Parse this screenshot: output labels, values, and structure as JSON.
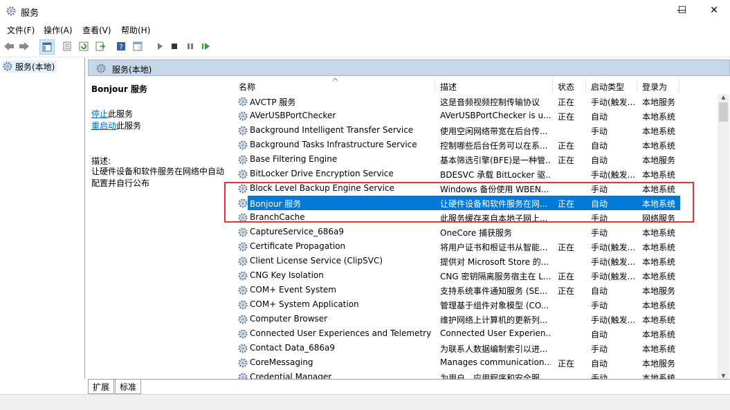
{
  "window": {
    "title": "服务",
    "minimize_icon": "minimize-icon",
    "maximize_icon": "maximize-icon",
    "close_icon": "close-icon"
  },
  "menu": [
    "文件(F)",
    "操作(A)",
    "查看(V)",
    "帮助(H)"
  ],
  "toolbar_icons": [
    "back-arrow-icon",
    "forward-arrow-icon",
    "console-tree-icon",
    "properties-icon",
    "refresh-icon",
    "export-icon",
    "help-icon",
    "show-hide-icon",
    "play-icon",
    "stop-icon",
    "pause-icon",
    "resume-icon"
  ],
  "tree": {
    "root_label": "服务(本地)"
  },
  "panel": {
    "header": "服务(本地)"
  },
  "details": {
    "service_name": "Bonjour 服务",
    "stop_link": "停止",
    "stop_suffix": "此服务",
    "restart_link": "重启动",
    "restart_suffix": "此服务",
    "desc_label": "描述:",
    "desc_text": "让硬件设备和软件服务在网络中自动配置并自行公布"
  },
  "columns": {
    "name": "名称",
    "desc": "描述",
    "status": "状态",
    "startup": "启动类型",
    "logon": "登录为"
  },
  "services": [
    {
      "name": "AVCTP 服务",
      "desc": "这是音频视频控制传输协议",
      "status": "正在",
      "startup": "手动(触发...",
      "logon": "本地服务"
    },
    {
      "name": "AVerUSBPortChecker",
      "desc": "AVerUSBPortChecker is u...",
      "status": "正在",
      "startup": "自动",
      "logon": "本地系统"
    },
    {
      "name": "Background Intelligent Transfer Service",
      "desc": "使用空闲网络带宽在后台传...",
      "status": "",
      "startup": "手动",
      "logon": "本地系统"
    },
    {
      "name": "Background Tasks Infrastructure Service",
      "desc": "控制哪些后台任务可以在系...",
      "status": "正在",
      "startup": "自动",
      "logon": "本地系统"
    },
    {
      "name": "Base Filtering Engine",
      "desc": "基本筛选引擎(BFE)是一种管...",
      "status": "正在",
      "startup": "自动",
      "logon": "本地服务"
    },
    {
      "name": "BitLocker Drive Encryption Service",
      "desc": "BDESVC 承载 BitLocker 驱...",
      "status": "",
      "startup": "手动(触发...",
      "logon": "本地系统"
    },
    {
      "name": "Block Level Backup Engine Service",
      "desc": "Windows 备份使用 WBEN...",
      "status": "",
      "startup": "手动",
      "logon": "本地系统"
    },
    {
      "name": "Bonjour 服务",
      "desc": "让硬件设备和软件服务在网...",
      "status": "正在",
      "startup": "自动",
      "logon": "本地系统",
      "selected": true
    },
    {
      "name": "BranchCache",
      "desc": "此服务缓存来自本地子网上...",
      "status": "",
      "startup": "手动",
      "logon": "网络服务"
    },
    {
      "name": "CaptureService_686a9",
      "desc": "OneCore 捕获服务",
      "status": "",
      "startup": "手动",
      "logon": "本地系统"
    },
    {
      "name": "Certificate Propagation",
      "desc": "将用户证书和根证书从智能...",
      "status": "正在",
      "startup": "手动(触发...",
      "logon": "本地系统"
    },
    {
      "name": "Client License Service (ClipSVC)",
      "desc": "提供对 Microsoft Store 的...",
      "status": "",
      "startup": "手动(触发...",
      "logon": "本地系统"
    },
    {
      "name": "CNG Key Isolation",
      "desc": "CNG 密钥隔离服务宿主在 L...",
      "status": "正在",
      "startup": "手动(触发...",
      "logon": "本地系统"
    },
    {
      "name": "COM+ Event System",
      "desc": "支持系统事件通知服务 (SE...",
      "status": "正在",
      "startup": "自动",
      "logon": "本地服务"
    },
    {
      "name": "COM+ System Application",
      "desc": "管理基于组件对象模型 (CO...",
      "status": "",
      "startup": "手动",
      "logon": "本地系统"
    },
    {
      "name": "Computer Browser",
      "desc": "维护网络上计算机的更新列...",
      "status": "",
      "startup": "手动(触发...",
      "logon": "本地系统"
    },
    {
      "name": "Connected User Experiences and Telemetry",
      "desc": "Connected User Experien...",
      "status": "",
      "startup": "自动",
      "logon": "本地系统"
    },
    {
      "name": "Contact Data_686a9",
      "desc": "为联系人数据编制索引以进...",
      "status": "",
      "startup": "手动",
      "logon": "本地系统"
    },
    {
      "name": "CoreMessaging",
      "desc": "Manages communication...",
      "status": "正在",
      "startup": "自动",
      "logon": "本地服务"
    },
    {
      "name": "Credential Manager",
      "desc": "为用户、应用程序和安全服...",
      "status": "",
      "startup": "手动",
      "logon": "本地系统"
    }
  ],
  "tabs": [
    "扩展",
    "标准"
  ],
  "colors": {
    "selection": "#0078d7",
    "highlight_box": "#e8303a",
    "header_bg": "#c6d7ea",
    "link": "#0066cc"
  }
}
